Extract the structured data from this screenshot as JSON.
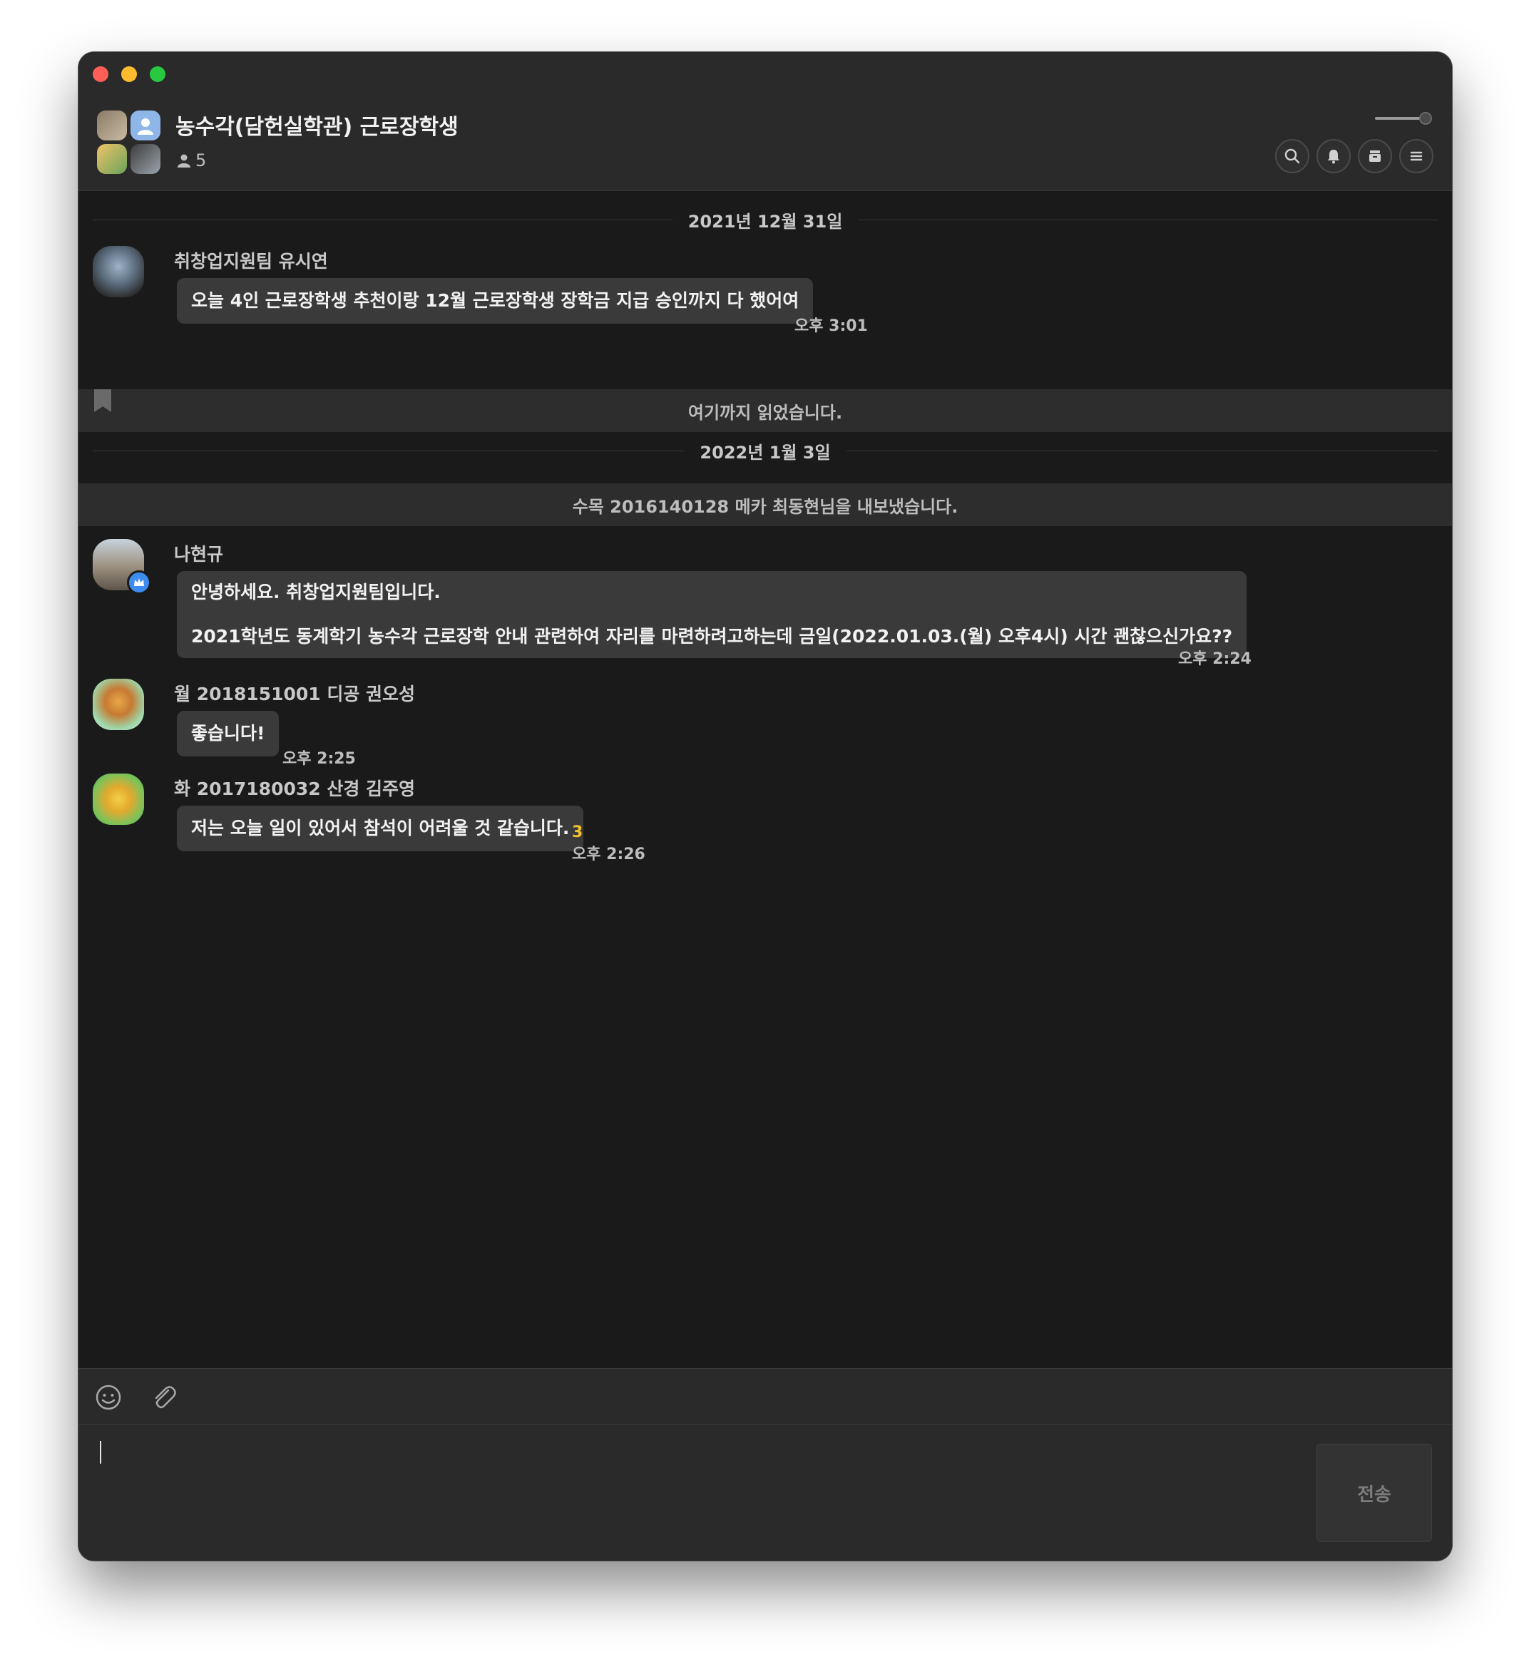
{
  "header": {
    "title": "농수각(담헌실학관) 근로장학생",
    "member_count": "5"
  },
  "dates": {
    "d1": "2021년 12월 31일",
    "d2": "2022년 1월 3일"
  },
  "system": {
    "read_marker": "여기까지 읽었습니다.",
    "kicked": "수목 2016140128 메카 최동현님을 내보냈습니다."
  },
  "messages": [
    {
      "sender": "취창업지원팀 유시연",
      "text": "오늘 4인 근로장학생 추천이랑 12월 근로장학생 장학금 지급 승인까지 다 했어여",
      "time": "오후 3:01"
    },
    {
      "sender": "나현규",
      "line1": "안녕하세요. 취창업지원팀입니다.",
      "line2": "2021학년도 동계학기 농수각 근로장학 안내 관련하여 자리를 마련하려고하는데 금일(2022.01.03.(월) 오후4시) 시간 괜찮으신가요??",
      "time": "오후 2:24"
    },
    {
      "sender": "월 2018151001 디공 권오성",
      "text": "좋습니다!",
      "time": "오후 2:25"
    },
    {
      "sender": "화 2017180032 산경 김주영",
      "text": "저는 오늘 일이 있어서 참석이 어려울 것 같습니다.",
      "unread": "3",
      "time": "오후 2:26"
    }
  ],
  "composer": {
    "send_label": "전송",
    "input_value": ""
  },
  "icons": {
    "toolbar": [
      "emoji-icon",
      "attach-icon"
    ],
    "header": [
      "search-icon",
      "bell-icon",
      "drawer-icon",
      "menu-icon"
    ]
  }
}
